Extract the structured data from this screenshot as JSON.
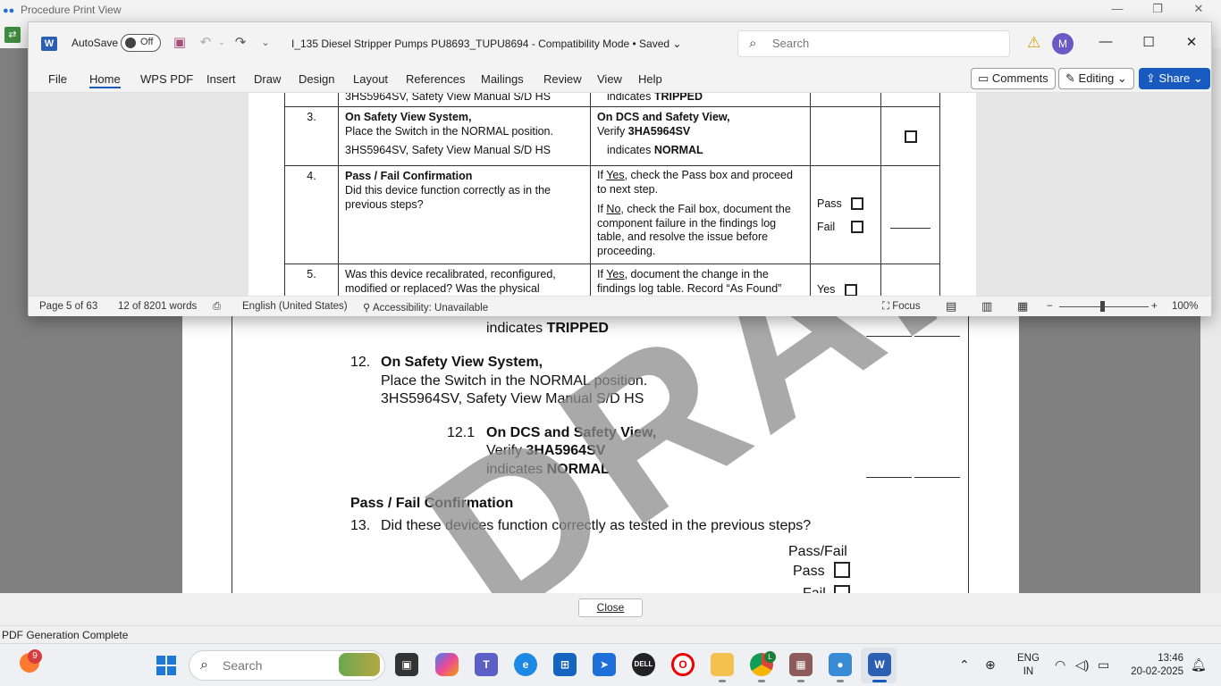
{
  "background_app": {
    "title": "Procedure Print View",
    "document": {
      "line_tripped_prefix": "indicates ",
      "line_tripped_bold": "TRIPPED",
      "step12_num": "12.",
      "step12_title": "On Safety View System,",
      "step12_line1": "Place the Switch in the NORMAL position.",
      "step12_line2": "3HS5964SV, Safety View Manual S/D HS",
      "step121_num": "12.1",
      "step121_title": "On DCS and Safety View,",
      "step121_verify_prefix": "Verify ",
      "step121_verify_bold": "3HA5964SV",
      "step121_ind_prefix": "indicates ",
      "step121_ind_bold": "NORMAL",
      "pass_fail_heading": "Pass / Fail Confirmation",
      "step13_num": "13.",
      "step13_text": "Did these devices function correctly as tested in the previous steps?",
      "pass_fail_label": "Pass/Fail",
      "pass_label": "Pass",
      "fail_label": "Fail",
      "watermark": "DRAFT"
    },
    "close_button": "Close",
    "status": "PDF Generation Complete"
  },
  "word": {
    "autosave_label": "AutoSave",
    "autosave_state": "Off",
    "doc_title": "I_135 Diesel Stripper Pumps PU8693_TUPU8694  -  Compatibility Mode • Saved",
    "search_placeholder": "Search",
    "avatar_initial": "M",
    "tabs": [
      "File",
      "Home",
      "WPS PDF",
      "Insert",
      "Draw",
      "Design",
      "Layout",
      "References",
      "Mailings",
      "Review",
      "View",
      "Help"
    ],
    "comments_label": "Comments",
    "editing_label": "Editing",
    "share_label": "Share",
    "table": {
      "row0_left": "3HS5964SV, Safety View Manual S/D HS",
      "row0_mid_prefix": "indicates ",
      "row0_mid_bold": "TRIPPED",
      "row3": {
        "num": "3.",
        "title": "On Safety View System,",
        "line1": "Place the Switch in the NORMAL position.",
        "line2": "3HS5964SV, Safety View Manual S/D HS",
        "mid_title": "On DCS and Safety View,",
        "mid_verify_prefix": "Verify ",
        "mid_verify_bold": "3HA5964SV",
        "mid_ind_prefix": "indicates ",
        "mid_ind_bold": "NORMAL"
      },
      "row4": {
        "num": "4.",
        "title": "Pass / Fail Confirmation",
        "text": "Did this device function correctly as in the previous steps?",
        "yes_prefix": "If ",
        "yes_word": "Yes",
        "yes_rest": ", check the Pass box and proceed to next step.",
        "no_prefix": "If ",
        "no_word": "No",
        "no_rest": ", check the Fail box, document the component failure in the findings log table, and resolve the issue before proceeding.",
        "pass": "Pass",
        "fail": "Fail"
      },
      "row5": {
        "num": "5.",
        "text": "Was this device recalibrated, reconfigured, modified or replaced?  Was the physical",
        "yes_prefix": "If ",
        "yes_word": "Yes",
        "yes_rest": ", document the change in the findings log table.  Record “As Found”",
        "yes_label": "Yes"
      }
    },
    "status": {
      "page": "Page 5 of 63",
      "words": "12 of 8201 words",
      "language": "English (United States)",
      "accessibility": "Accessibility: Unavailable",
      "focus": "Focus",
      "zoom": "100%",
      "zoom_minus": "−",
      "zoom_plus": "+"
    }
  },
  "taskbar": {
    "widget_badge": "9",
    "search_placeholder": "Search",
    "chrome_badge": "L",
    "lang_line1": "ENG",
    "lang_line2": "IN",
    "time": "13:46",
    "date": "20-02-2025"
  },
  "colors": {
    "word_blue": "#185abd",
    "viewer_gray": "#808080",
    "warning_yellow": "#d6a000",
    "avatar_purple": "#6a5ac4"
  }
}
